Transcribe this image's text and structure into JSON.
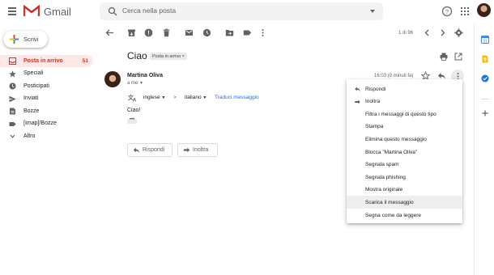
{
  "app": {
    "name": "Gmail"
  },
  "search": {
    "placeholder": "Cerca nella posta"
  },
  "compose": {
    "label": "Scrivi"
  },
  "sidebar": {
    "items": [
      {
        "label": "Posta in arrivo",
        "count": "51"
      },
      {
        "label": "Speciali"
      },
      {
        "label": "Posticipati"
      },
      {
        "label": "Inviati"
      },
      {
        "label": "Bozze"
      },
      {
        "label": "[Imap]/Bozze"
      },
      {
        "label": "Altro"
      }
    ]
  },
  "toolbar": {
    "pager": "1 di 96"
  },
  "message": {
    "subject": "Ciao",
    "label_chip": "Posta in arrivo ×",
    "sender": "Martina Oliva",
    "to": "a me",
    "time": "16:03 (9 minuti fa)",
    "body": "Ciao!",
    "ellipsis": "•••"
  },
  "translate": {
    "from": "inglese",
    "arrow": ">",
    "to": "italiano",
    "link": "Traduci messaggio"
  },
  "actions": {
    "reply": "Rispondi",
    "forward": "Inoltra"
  },
  "menu": {
    "items": [
      "Rispondi",
      "Inoltra",
      "Filtra i messaggi di questo tipo",
      "Stampa",
      "Elimina questo messaggio",
      "Blocca \"Martina Oliva\"",
      "Segnala spam",
      "Segnala phishing",
      "Mostra originale",
      "Scarica il messaggio",
      "Segna come da leggere"
    ],
    "hovered": "Scarica il messaggio"
  },
  "colors": {
    "accent_red": "#d93025",
    "active_bg": "#fce8e6",
    "link_blue": "#1a73e8",
    "hover_bg": "#eeeeee"
  }
}
